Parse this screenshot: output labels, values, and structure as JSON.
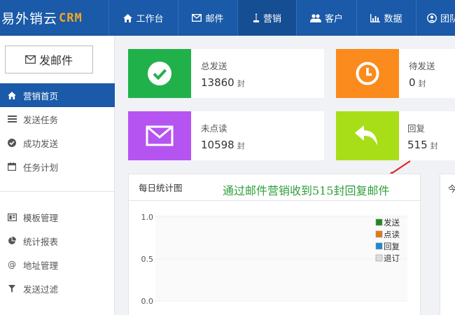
{
  "brand": {
    "name": "易外销云",
    "suffix": "CRM"
  },
  "nav": [
    {
      "label": "工作台",
      "icon": "home-icon"
    },
    {
      "label": "邮件",
      "icon": "mail-icon"
    },
    {
      "label": "营销",
      "icon": "marketing-icon"
    },
    {
      "label": "客户",
      "icon": "users-icon"
    },
    {
      "label": "数据",
      "icon": "bar-chart-icon"
    },
    {
      "label": "团队",
      "icon": "user-circle-icon"
    }
  ],
  "sidebar": {
    "compose_label": "发邮件",
    "items": [
      {
        "label": "营销首页",
        "icon": "home-icon"
      },
      {
        "label": "发送任务",
        "icon": "list-icon"
      },
      {
        "label": "成功发送",
        "icon": "check-circle-icon"
      },
      {
        "label": "任务计划",
        "icon": "calendar-icon"
      },
      {
        "label": "模板管理",
        "icon": "template-icon"
      },
      {
        "label": "统计报表",
        "icon": "pie-chart-icon"
      },
      {
        "label": "地址管理",
        "icon": "at-icon"
      },
      {
        "label": "发送过滤",
        "icon": "filter-icon"
      }
    ]
  },
  "stats": {
    "sent": {
      "label": "总发送",
      "value": "13860",
      "unit": "封"
    },
    "pending": {
      "label": "待发送",
      "value": "0",
      "unit": "封"
    },
    "unread": {
      "label": "未点读",
      "value": "10598",
      "unit": "封"
    },
    "reply": {
      "label": "回复",
      "value": "515",
      "unit": "封"
    }
  },
  "colors": {
    "green": "#21b14b",
    "orange": "#fb8b1c",
    "purple": "#b554f0",
    "lime": "#a8de17",
    "navy": "#1a5aa8"
  },
  "panel": {
    "title": "每日统计图",
    "second_panel_glyph": "今"
  },
  "annotation": "通过邮件营销收到515封回复邮件",
  "chart_data": {
    "type": "line",
    "title": "每日统计图",
    "y_ticks": [
      "1.0",
      "0.5",
      "0.0"
    ],
    "ylim": [
      0,
      1.0
    ],
    "legend_position": "top-right",
    "series": [
      {
        "name": "发送",
        "color": "#1e8a1e",
        "values": []
      },
      {
        "name": "点读",
        "color": "#e07b14",
        "values": []
      },
      {
        "name": "回复",
        "color": "#1a8ad0",
        "values": []
      },
      {
        "name": "退订",
        "color": "#dddddd",
        "values": []
      }
    ]
  }
}
